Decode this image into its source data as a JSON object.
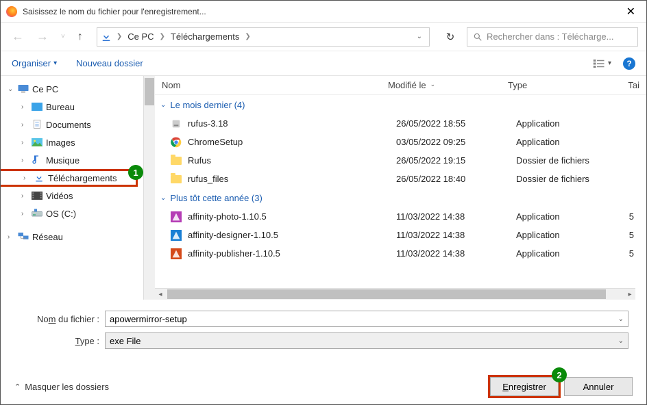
{
  "title": "Saisissez le nom du fichier pour l'enregistrement...",
  "breadcrumb": {
    "root": "Ce PC",
    "folder": "Téléchargements"
  },
  "search_placeholder": "Rechercher dans : Télécharge...",
  "toolbar": {
    "organize": "Organiser",
    "new_folder": "Nouveau dossier"
  },
  "columns": {
    "name": "Nom",
    "modified": "Modifié le",
    "type": "Type",
    "size": "Tai"
  },
  "tree": {
    "thispc": "Ce PC",
    "desktop": "Bureau",
    "documents": "Documents",
    "pictures": "Images",
    "music": "Musique",
    "downloads": "Téléchargements",
    "videos": "Vidéos",
    "osdrive": "OS (C:)",
    "network": "Réseau"
  },
  "groups": [
    {
      "label": "Le mois dernier (4)",
      "rows": [
        {
          "icon": "app",
          "name": "rufus-3.18",
          "date": "26/05/2022 18:55",
          "type": "Application",
          "size": ""
        },
        {
          "icon": "chrome",
          "name": "ChromeSetup",
          "date": "03/05/2022 09:25",
          "type": "Application",
          "size": ""
        },
        {
          "icon": "folder",
          "name": "Rufus",
          "date": "26/05/2022 19:15",
          "type": "Dossier de fichiers",
          "size": ""
        },
        {
          "icon": "folder",
          "name": "rufus_files",
          "date": "26/05/2022 18:40",
          "type": "Dossier de fichiers",
          "size": ""
        }
      ]
    },
    {
      "label": "Plus tôt cette année (3)",
      "rows": [
        {
          "icon": "aff-photo",
          "name": "affinity-photo-1.10.5",
          "date": "11/03/2022 14:38",
          "type": "Application",
          "size": "5"
        },
        {
          "icon": "aff-designer",
          "name": "affinity-designer-1.10.5",
          "date": "11/03/2022 14:38",
          "type": "Application",
          "size": "5"
        },
        {
          "icon": "aff-publisher",
          "name": "affinity-publisher-1.10.5",
          "date": "11/03/2022 14:38",
          "type": "Application",
          "size": "5"
        }
      ]
    }
  ],
  "filename_label_pre": "No",
  "filename_label_ul": "m",
  "filename_label_post": " du fichier :",
  "type_label_ul": "T",
  "type_label_post": "ype :",
  "filename_value": "apowermirror-setup",
  "type_value": "exe File",
  "hide_folders": "Masquer les dossiers",
  "save": "Enregistrer",
  "cancel": "Annuler",
  "badges": {
    "one": "1",
    "two": "2"
  }
}
